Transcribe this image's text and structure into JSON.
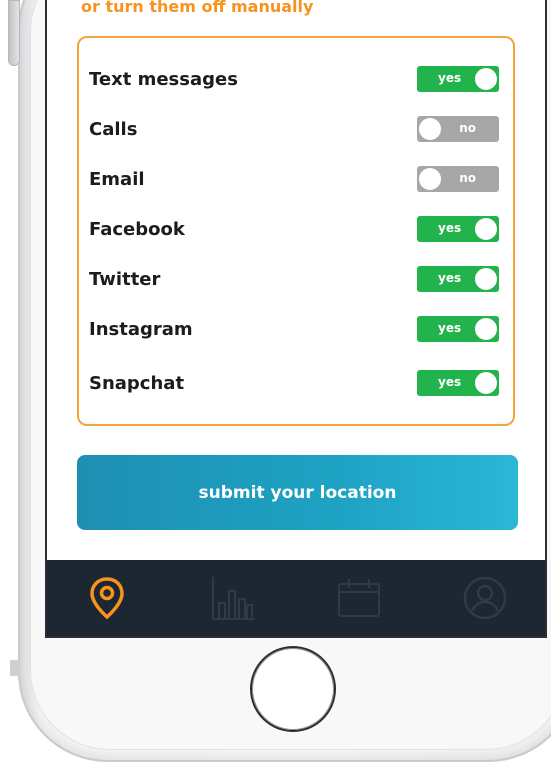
{
  "subtitle": "or turn them off manually",
  "settings": [
    {
      "label": "Text messages",
      "state": "yes",
      "on": true
    },
    {
      "label": "Calls",
      "state": "no",
      "on": false
    },
    {
      "label": "Email",
      "state": "no",
      "on": false
    },
    {
      "label": "Facebook",
      "state": "yes",
      "on": true
    },
    {
      "label": "Twitter",
      "state": "yes",
      "on": true
    },
    {
      "label": "Instagram",
      "state": "yes",
      "on": true
    },
    {
      "label": "Snapchat",
      "state": "yes",
      "on": true
    }
  ],
  "submit_label": "submit your location",
  "tabs": [
    {
      "icon": "location-pin-icon",
      "active": true
    },
    {
      "icon": "bar-chart-icon",
      "active": false
    },
    {
      "icon": "calendar-icon",
      "active": false
    },
    {
      "icon": "profile-icon",
      "active": false
    }
  ],
  "colors": {
    "accent": "#f7931e",
    "toggle_on": "#22b34d",
    "toggle_off": "#a7a7a7",
    "button": "#1ea3c4",
    "tabbar": "#1d2731"
  }
}
